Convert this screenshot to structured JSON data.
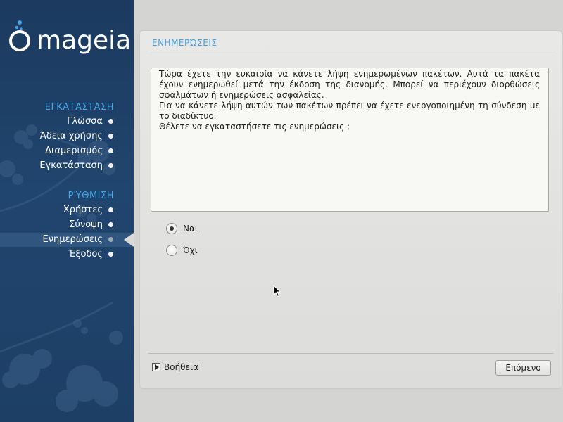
{
  "sidebar": {
    "logo_text": "mageia",
    "sections": [
      {
        "title": "ΕΓΚΑΤΑΣΤΑΣΗ",
        "items": [
          {
            "label": "Γλώσσα"
          },
          {
            "label": "Άδεια χρήσης"
          },
          {
            "label": "Διαμερισμός"
          },
          {
            "label": "Εγκατάσταση"
          }
        ]
      },
      {
        "title": "ΡΎΘΜΙΣΗ",
        "items": [
          {
            "label": "Χρήστες"
          },
          {
            "label": "Σύνοψη"
          },
          {
            "label": "Ενημερώσεις",
            "active": true
          },
          {
            "label": "Έξοδος"
          }
        ]
      }
    ]
  },
  "panel": {
    "title": "ΕΝΗΜΕΡΏΣΕΙΣ",
    "description": [
      "Τώρα έχετε την ευκαιρία να κάνετε λήψη ενημερωμένων πακέτων. Αυτά τα πακέτα έχουν ενημερωθεί μετά την έκδοση της διανομής. Μπορεί να περιέχουν διορθώσεις σφαλμάτων ή ενημερώσεις ασφαλείας.",
      "Για να κάνετε λήψη αυτών των πακέτων πρέπει να έχετε ενεργοποιημένη τη σύνδεση με το διαδίκτυο.",
      "Θέλετε να εγκαταστήσετε τις ενημερώσεις ;"
    ],
    "options": [
      {
        "label": "Ναι",
        "checked": true
      },
      {
        "label": "Όχι",
        "checked": false
      }
    ],
    "help_label": "Βοήθεια",
    "next_label": "Επόμενο"
  },
  "colors": {
    "sidebar_bg": "#1c3a5f",
    "accent": "#45a5e6",
    "panel_bg": "#e4e4e2"
  }
}
